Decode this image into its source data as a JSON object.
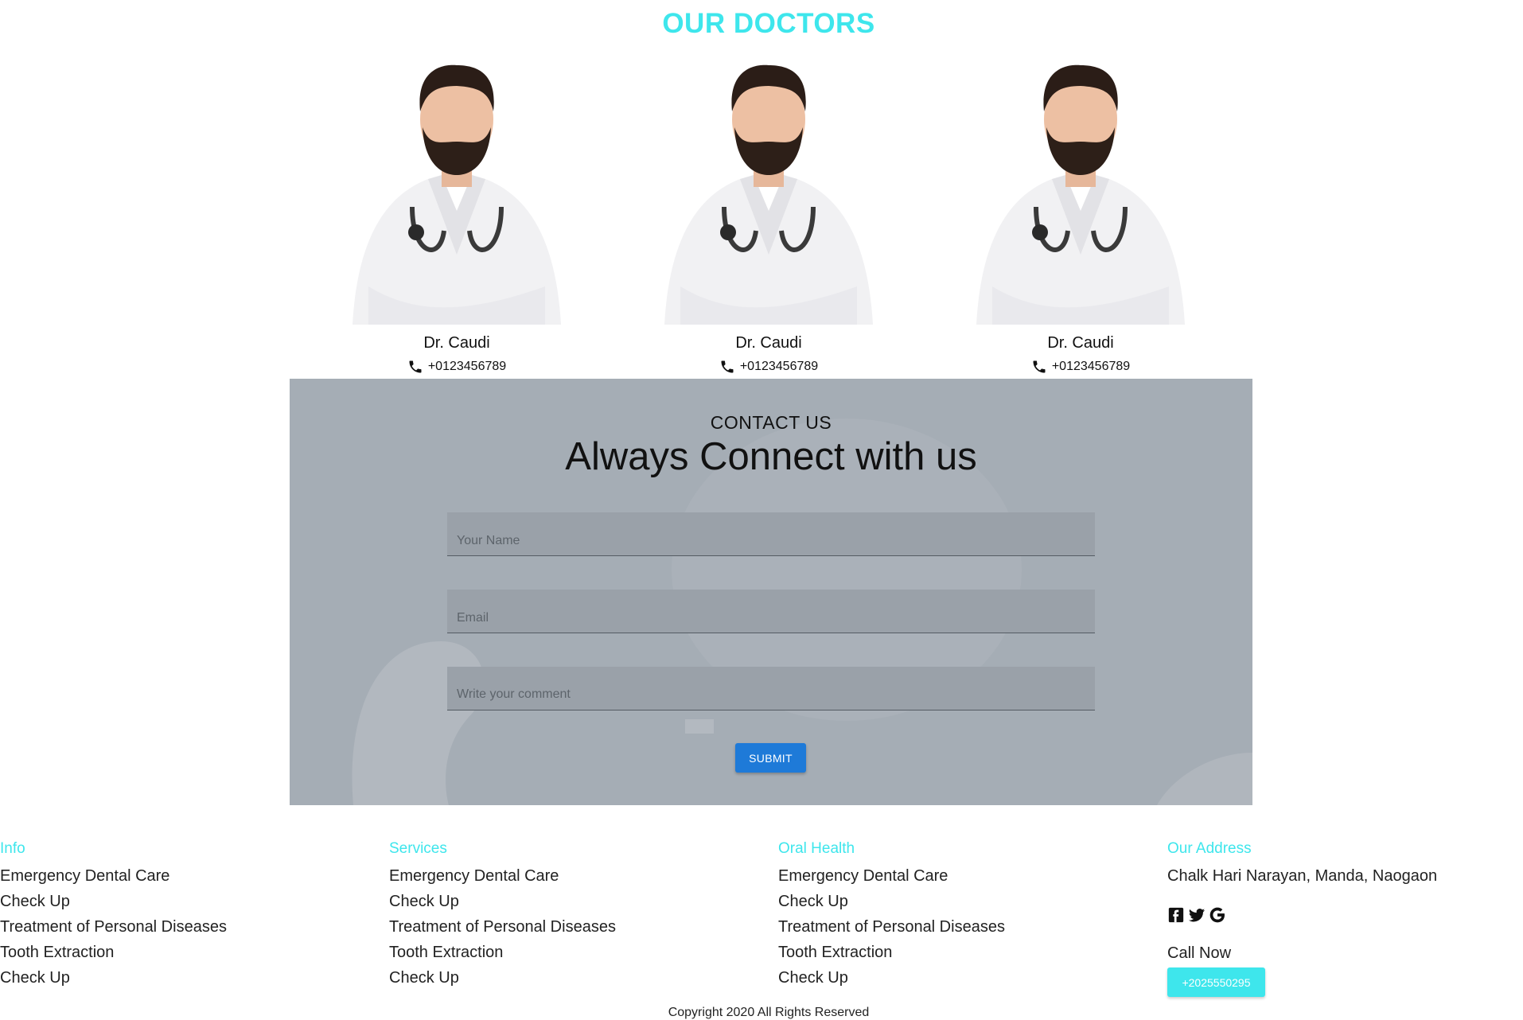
{
  "doctors_section": {
    "title": "OUR DOCTORS",
    "doctors": [
      {
        "name": "Dr. Caudi",
        "phone": "+0123456789"
      },
      {
        "name": "Dr. Caudi",
        "phone": "+0123456789"
      },
      {
        "name": "Dr. Caudi",
        "phone": "+0123456789"
      }
    ]
  },
  "contact": {
    "eyebrow": "CONTACT US",
    "heading": "Always Connect with us",
    "name_placeholder": "Your Name",
    "email_placeholder": "Email",
    "comment_placeholder": "Write your comment",
    "submit_label": "SUBMIT"
  },
  "footer": {
    "columns": [
      {
        "heading": "Info",
        "links": [
          "Emergency Dental Care",
          "Check Up",
          "Treatment of Personal Diseases",
          "Tooth Extraction",
          "Check Up"
        ]
      },
      {
        "heading": "Services",
        "links": [
          "Emergency Dental Care",
          "Check Up",
          "Treatment of Personal Diseases",
          "Tooth Extraction",
          "Check Up"
        ]
      },
      {
        "heading": "Oral Health",
        "links": [
          "Emergency Dental Care",
          "Check Up",
          "Treatment of Personal Diseases",
          "Tooth Extraction",
          "Check Up"
        ]
      }
    ],
    "address": {
      "heading": "Our Address",
      "text": "Chalk Hari Narayan, Manda, Naogaon",
      "social_icons": [
        "facebook-icon",
        "twitter-icon",
        "google-icon"
      ],
      "call_label": "Call Now",
      "call_number": "+2025550295"
    },
    "copyright": "Copyright 2020 All Rights Reserved"
  },
  "colors": {
    "accent": "#3ee6ec",
    "submit": "#1e7ad8",
    "contact_bg": "#a5adb5"
  }
}
